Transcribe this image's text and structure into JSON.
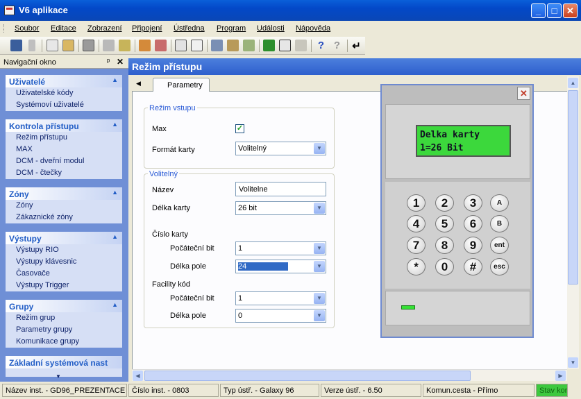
{
  "window": {
    "title": "V6 aplikace",
    "min": "_",
    "max": "□",
    "close": "✕"
  },
  "menu": [
    "Soubor",
    "Editace",
    "Zobrazení",
    "Připojení",
    "Ústředna",
    "Program",
    "Události",
    "Nápověda"
  ],
  "nav": {
    "title": "Navigační okno",
    "pin": "ᵖ",
    "close": "✕",
    "groups": [
      {
        "title": "Uživatelé",
        "items": [
          "Uživatelské kódy",
          "Systémoví uživatelé"
        ]
      },
      {
        "title": "Kontrola přístupu",
        "items": [
          "Režim přístupu",
          "MAX",
          "DCM - dveřní modul",
          "DCM - čtečky"
        ]
      },
      {
        "title": "Zóny",
        "items": [
          "Zóny",
          "Zákaznické zóny"
        ]
      },
      {
        "title": "Výstupy",
        "items": [
          "Výstupy RIO",
          "Výstupy klávesnic",
          "Časovače",
          "Výstupy Trigger"
        ]
      },
      {
        "title": "Grupy",
        "items": [
          "Režim grup",
          "Parametry grupy",
          "Komunikace grupy"
        ]
      },
      {
        "title": "Základní systémová nast",
        "items": []
      }
    ]
  },
  "main": {
    "title": "Režim přístupu",
    "tab": "Parametry",
    "vstup": {
      "legend": "Režim vstupu",
      "max_label": "Max",
      "max_checked": true,
      "format_label": "Formát karty",
      "format_value": "Volitelný"
    },
    "volitelny": {
      "legend": "Volitelný",
      "nazev_label": "Název",
      "nazev_value": "Volitelne",
      "delka_label": "Délka karty",
      "delka_value": "26 bit",
      "cislo_label": "Číslo karty",
      "pocatecni_label": "Počáteční bit",
      "pocatecni_value": "1",
      "delka_pole_label": "Délka pole",
      "delka_pole_value": "24",
      "facility_label": "Facility kód",
      "fac_pocatecni_label": "Počáteční bit",
      "fac_pocatecni_value": "1",
      "fac_delka_label": "Délka pole",
      "fac_delka_value": "0"
    }
  },
  "keypad": {
    "lcd_line1": "Delka karty",
    "lcd_line2": "1=26 Bit",
    "keys": [
      "1",
      "2",
      "3",
      "A",
      "4",
      "5",
      "6",
      "B",
      "7",
      "8",
      "9",
      "ent",
      "*",
      "0",
      "#",
      "esc"
    ]
  },
  "status": [
    "Název inst. - GD96_PREZENTACE",
    "Číslo inst. - 0803",
    "Typ ústř. - Galaxy 96",
    "Verze ústř. - 6.50",
    "Komun.cesta - Přímo",
    "Stav kor"
  ]
}
